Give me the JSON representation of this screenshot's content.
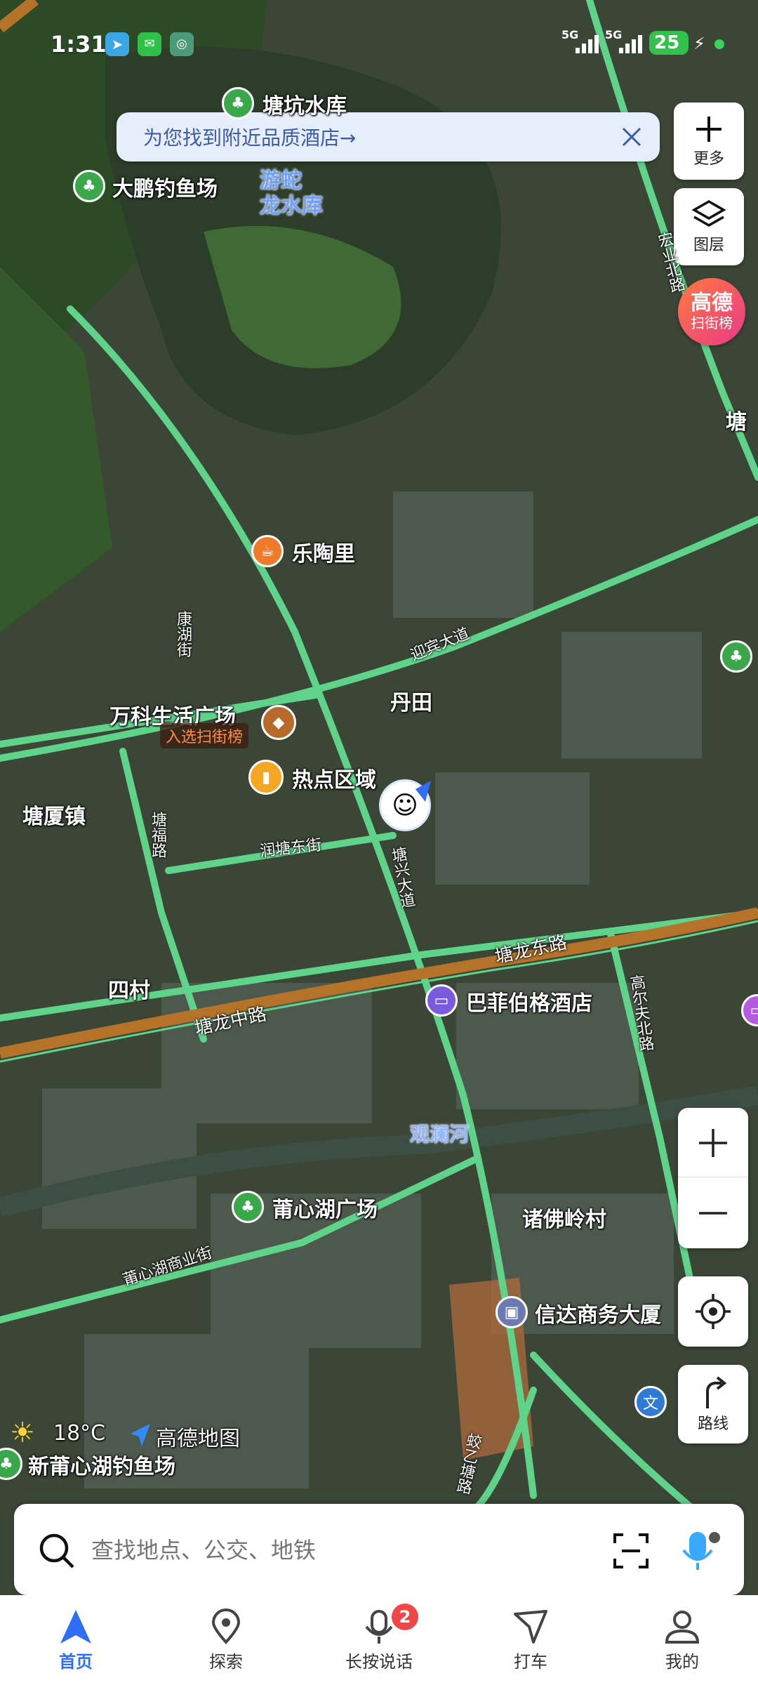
{
  "status_bar": {
    "time": "1:31",
    "network_1": "5G",
    "network_2": "5G",
    "battery": "25"
  },
  "banner": {
    "text": "为您找到附近品质酒店→"
  },
  "side_buttons": {
    "more_label": "更多",
    "layers_label": "图层",
    "rank_title": "高德",
    "rank_subtitle": "扫街榜"
  },
  "map": {
    "pois": [
      {
        "label": "塘坑水库"
      },
      {
        "label": "大鹏钓鱼场"
      },
      {
        "label": "游蛇\n龙水库"
      },
      {
        "label": "乐陶里"
      },
      {
        "label": "丹田"
      },
      {
        "label": "万科生活广场"
      },
      {
        "label": "入选扫街榜"
      },
      {
        "label": "热点区域"
      },
      {
        "label": "塘厦镇"
      },
      {
        "label": "四村"
      },
      {
        "label": "巴菲伯格酒店"
      },
      {
        "label": "观澜河"
      },
      {
        "label": "莆心湖广场"
      },
      {
        "label": "诸佛岭村"
      },
      {
        "label": "信达商务大厦"
      },
      {
        "label": "新莆心湖钓鱼场"
      },
      {
        "label": "塘"
      }
    ],
    "roads": [
      {
        "label": "迎宾大道"
      },
      {
        "label": "康湖街"
      },
      {
        "label": "塘福路"
      },
      {
        "label": "润塘东街"
      },
      {
        "label": "塘兴大道"
      },
      {
        "label": "塘龙东路"
      },
      {
        "label": "塘龙中路"
      },
      {
        "label": "高尔夫北路"
      },
      {
        "label": "莆心湖商业街"
      },
      {
        "label": "蛟乙塘路"
      },
      {
        "label": "宏业北路"
      }
    ],
    "weather": "18°C",
    "brand": "高德地图",
    "colors": {
      "road_green": "#5fd38a",
      "main_road": "#b5732a",
      "satellite_dark": "#35422f"
    }
  },
  "zoom": {
    "in_icon": "plus-icon",
    "out_icon": "minus-icon"
  },
  "right_controls": {
    "route_label": "路线"
  },
  "search": {
    "placeholder": "查找地点、公交、地铁"
  },
  "tabs": [
    {
      "label": "首页",
      "icon": "navigation-arrow-icon",
      "active": true
    },
    {
      "label": "探索",
      "icon": "location-pin-icon"
    },
    {
      "label": "长按说话",
      "icon": "microphone-icon",
      "badge": "2"
    },
    {
      "label": "打车",
      "icon": "taxi-icon"
    },
    {
      "label": "我的",
      "icon": "user-icon"
    }
  ],
  "accent_color": "#2f6df6"
}
